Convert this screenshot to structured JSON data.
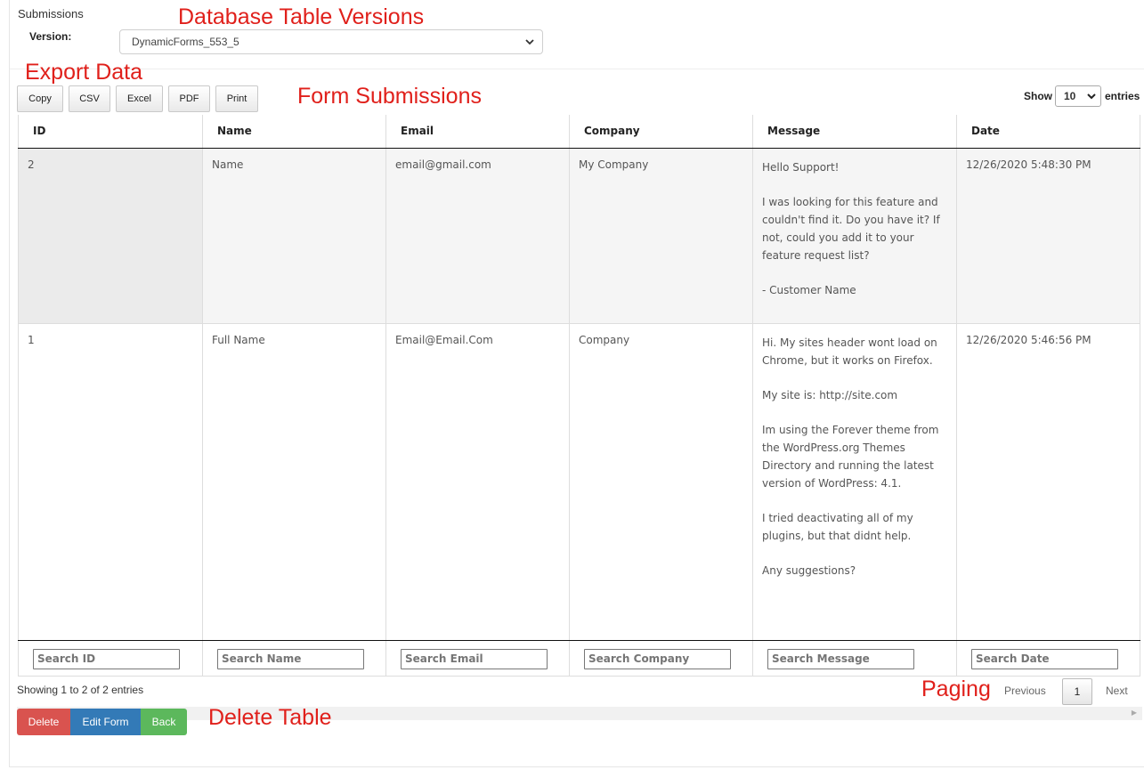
{
  "panel": {
    "title": "Submissions"
  },
  "version": {
    "label": "Version:",
    "selected": "DynamicForms_553_5"
  },
  "annotations": {
    "database": "Database Table Versions",
    "export": "Export Data",
    "form": "Form Submissions",
    "paging": "Paging",
    "delete": "Delete Table"
  },
  "export_buttons": {
    "copy": "Copy",
    "csv": "CSV",
    "excel": "Excel",
    "pdf": "PDF",
    "print": "Print"
  },
  "length": {
    "show": "Show",
    "value": "10",
    "entries": "entries"
  },
  "table": {
    "headers": [
      "ID",
      "Name",
      "Email",
      "Company",
      "Message",
      "Date"
    ],
    "rows": [
      {
        "id": "2",
        "name": "Name",
        "email": "email@gmail.com",
        "company": "My Company",
        "message": [
          "Hello Support!",
          "I was looking for this feature and couldn't find it. Do you have it? If not, could you add it to your feature request list?",
          "- Customer Name"
        ],
        "date": "12/26/2020 5:48:30 PM"
      },
      {
        "id": "1",
        "name": "Full Name",
        "email": "Email@Email.Com",
        "company": "Company",
        "message": [
          "Hi. My sites header wont load on Chrome, but it works on Firefox.",
          "My site is: http://site.com",
          "Im using the Forever theme from the WordPress.org Themes Directory and running the latest version of WordPress: 4.1.",
          "I tried deactivating all of my plugins, but that didnt help.",
          "Any suggestions?"
        ],
        "date": "12/26/2020 5:46:56 PM"
      }
    ],
    "search_placeholders": [
      "Search ID",
      "Search Name",
      "Search Email",
      "Search Company",
      "Search Message",
      "Search Date"
    ]
  },
  "info": "Showing 1 to 2 of 2 entries",
  "pagination": {
    "previous": "Previous",
    "page": "1",
    "next": "Next"
  },
  "actions": {
    "delete": "Delete",
    "edit": "Edit Form",
    "back": "Back"
  }
}
